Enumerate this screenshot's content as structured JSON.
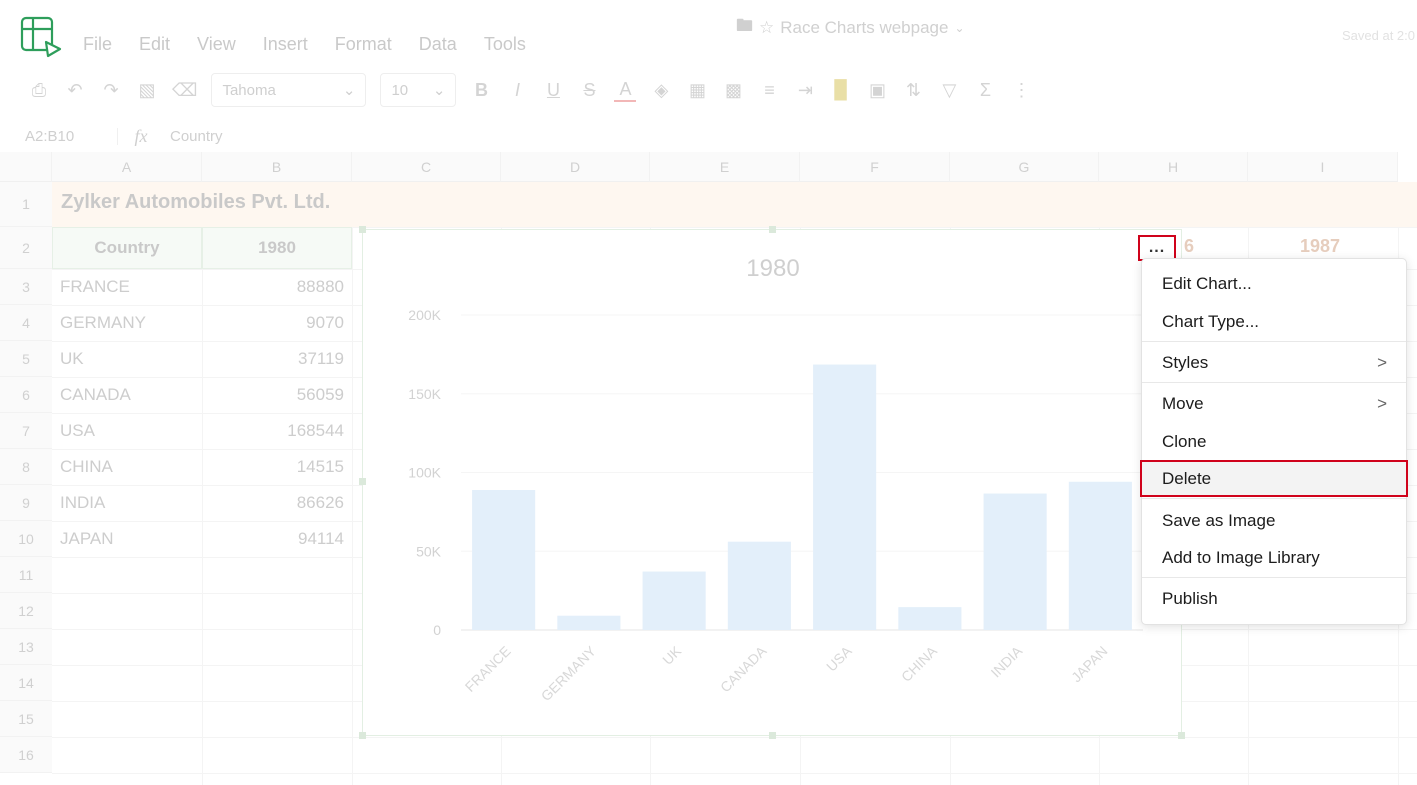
{
  "app": {
    "doc_title": "Race Charts webpage",
    "saved_status": "Saved at 2:0",
    "menu": [
      "File",
      "Edit",
      "View",
      "Insert",
      "Format",
      "Data",
      "Tools"
    ]
  },
  "toolbar": {
    "font_name": "Tahoma",
    "font_size": "10",
    "icons": [
      "print-icon",
      "undo-icon",
      "redo-icon",
      "paint-format-icon",
      "eraser-icon",
      "bold-icon",
      "italic-icon",
      "underline-icon",
      "strikethrough-icon",
      "text-color-icon",
      "fill-color-icon",
      "borders-icon",
      "merge-icon",
      "align-icon",
      "wrap-icon",
      "chart-icon",
      "image-icon",
      "sort-icon",
      "filter-icon",
      "sum-icon",
      "more-icon"
    ]
  },
  "formula_bar": {
    "cell_ref": "A2:B10",
    "fx": "fx",
    "value": "Country"
  },
  "grid": {
    "columns": [
      "A",
      "B",
      "C",
      "D",
      "E",
      "F",
      "G",
      "H",
      "I"
    ],
    "rows": [
      "1",
      "2",
      "3",
      "4",
      "5",
      "6",
      "7",
      "8",
      "9",
      "10",
      "11",
      "12",
      "13",
      "14",
      "15",
      "16"
    ],
    "title": "Zylker Automobiles Pvt. Ltd.",
    "header": [
      "Country",
      "1980"
    ],
    "right_headers": [
      "6",
      "1987"
    ],
    "data": [
      {
        "country": "FRANCE",
        "value": "88880"
      },
      {
        "country": "GERMANY",
        "value": "9070"
      },
      {
        "country": "UK",
        "value": "37119"
      },
      {
        "country": "CANADA",
        "value": "56059"
      },
      {
        "country": "USA",
        "value": "168544"
      },
      {
        "country": "CHINA",
        "value": "14515"
      },
      {
        "country": "INDIA",
        "value": "86626"
      },
      {
        "country": "JAPAN",
        "value": "94114"
      }
    ]
  },
  "chart_data": {
    "type": "bar",
    "title": "1980",
    "categories": [
      "FRANCE",
      "GERMANY",
      "UK",
      "CANADA",
      "USA",
      "CHINA",
      "INDIA",
      "JAPAN"
    ],
    "values": [
      88880,
      9070,
      37119,
      56059,
      168544,
      14515,
      86626,
      94114
    ],
    "ylim": [
      0,
      200000
    ],
    "yticks": [
      "0",
      "50K",
      "100K",
      "150K",
      "200K"
    ],
    "grid": true,
    "bar_color": "#e3effa"
  },
  "context_menu": {
    "trigger": "...",
    "items": [
      {
        "label": "Edit Chart...",
        "submenu": false
      },
      {
        "label": "Chart Type...",
        "submenu": false
      },
      {
        "label": "Styles",
        "submenu": true
      },
      {
        "label": "Move",
        "submenu": true
      },
      {
        "label": "Clone",
        "submenu": false
      },
      {
        "label": "Delete",
        "submenu": false,
        "highlighted": true
      },
      {
        "label": "Save as Image",
        "submenu": false
      },
      {
        "label": "Add to Image Library",
        "submenu": false
      },
      {
        "label": "Publish",
        "submenu": false
      }
    ],
    "chevron": ">",
    "highlight_color": "#d0021b"
  }
}
